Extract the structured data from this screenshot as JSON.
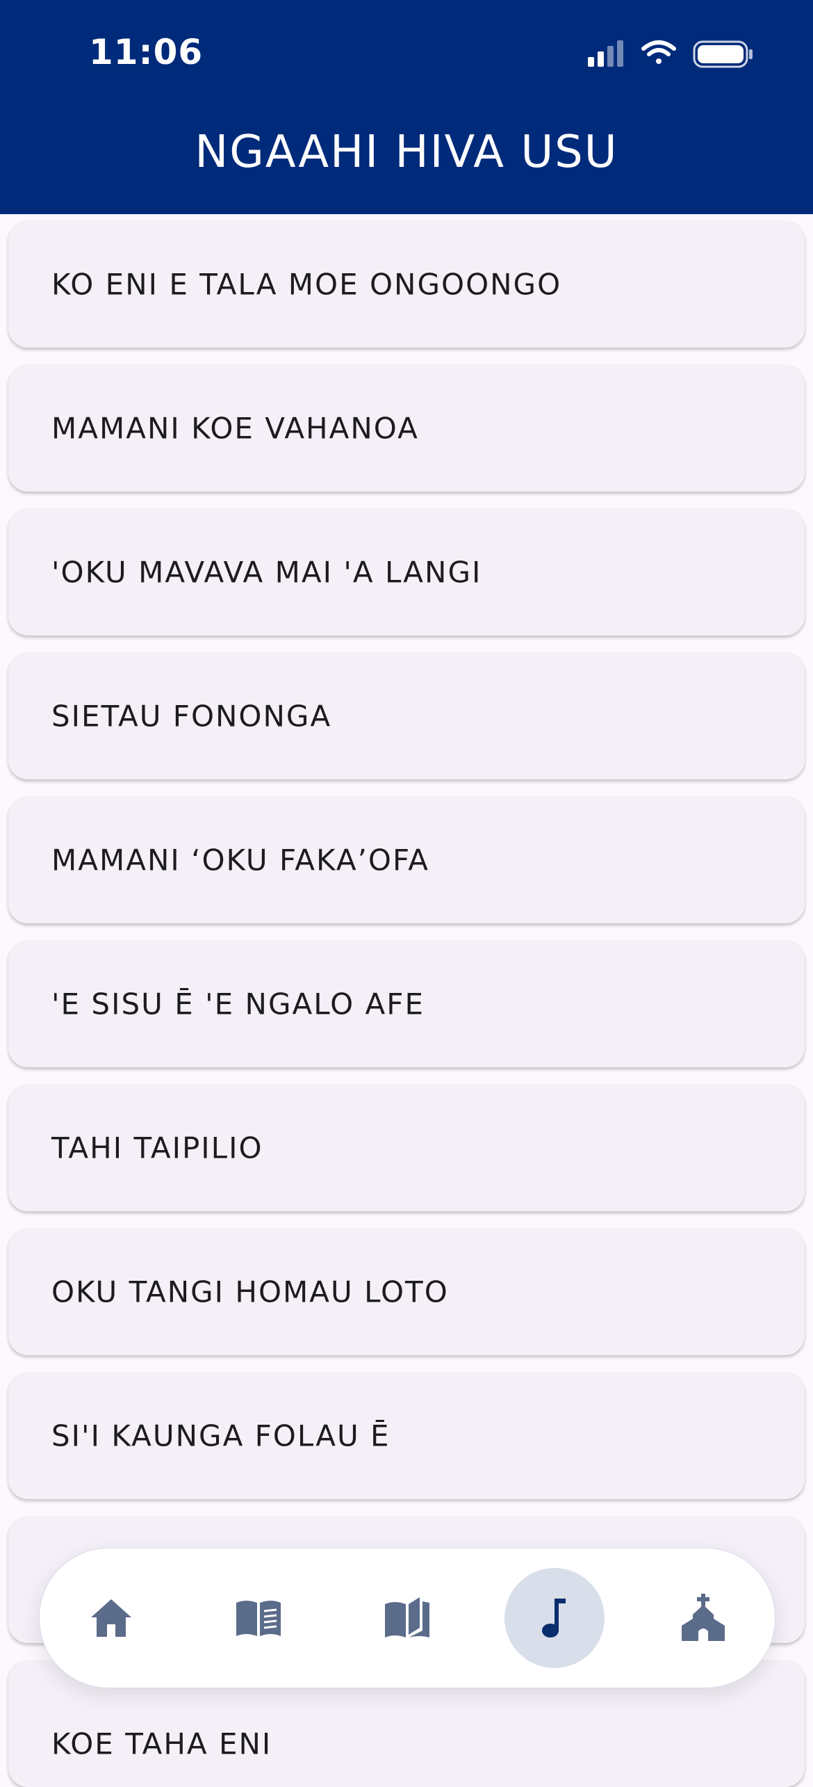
{
  "status_bar": {
    "time": "11:06"
  },
  "header": {
    "title": "NGAAHI HIVA USU"
  },
  "songs": [
    "KO ENI E TALA MOE ONGOONGO",
    "MAMANI KOE VAHANOA",
    "'OKU MAVAVA MAI 'A LANGI",
    "SIETAU FONONGA",
    "MAMANI ‘OKU FAKA’OFA",
    "'E SISU Ē 'E NGALO AFE",
    "TAHI TAIPILIO",
    "OKU TANGI HOMAU LOTO",
    "SI'I KAUNGA FOLAU Ē",
    "",
    "KOE TAHA ENI"
  ],
  "nav": {
    "items": [
      {
        "icon": "home-icon"
      },
      {
        "icon": "book-list-icon"
      },
      {
        "icon": "open-book-icon"
      },
      {
        "icon": "music-note-icon"
      },
      {
        "icon": "church-icon"
      }
    ],
    "active_index": 3
  },
  "colors": {
    "header_bg": "#002A7A",
    "row_bg": "#F5F0F8",
    "icon": "#5B6B8A",
    "active_icon": "#0A2D6E",
    "active_bg": "#D8DEEA"
  }
}
